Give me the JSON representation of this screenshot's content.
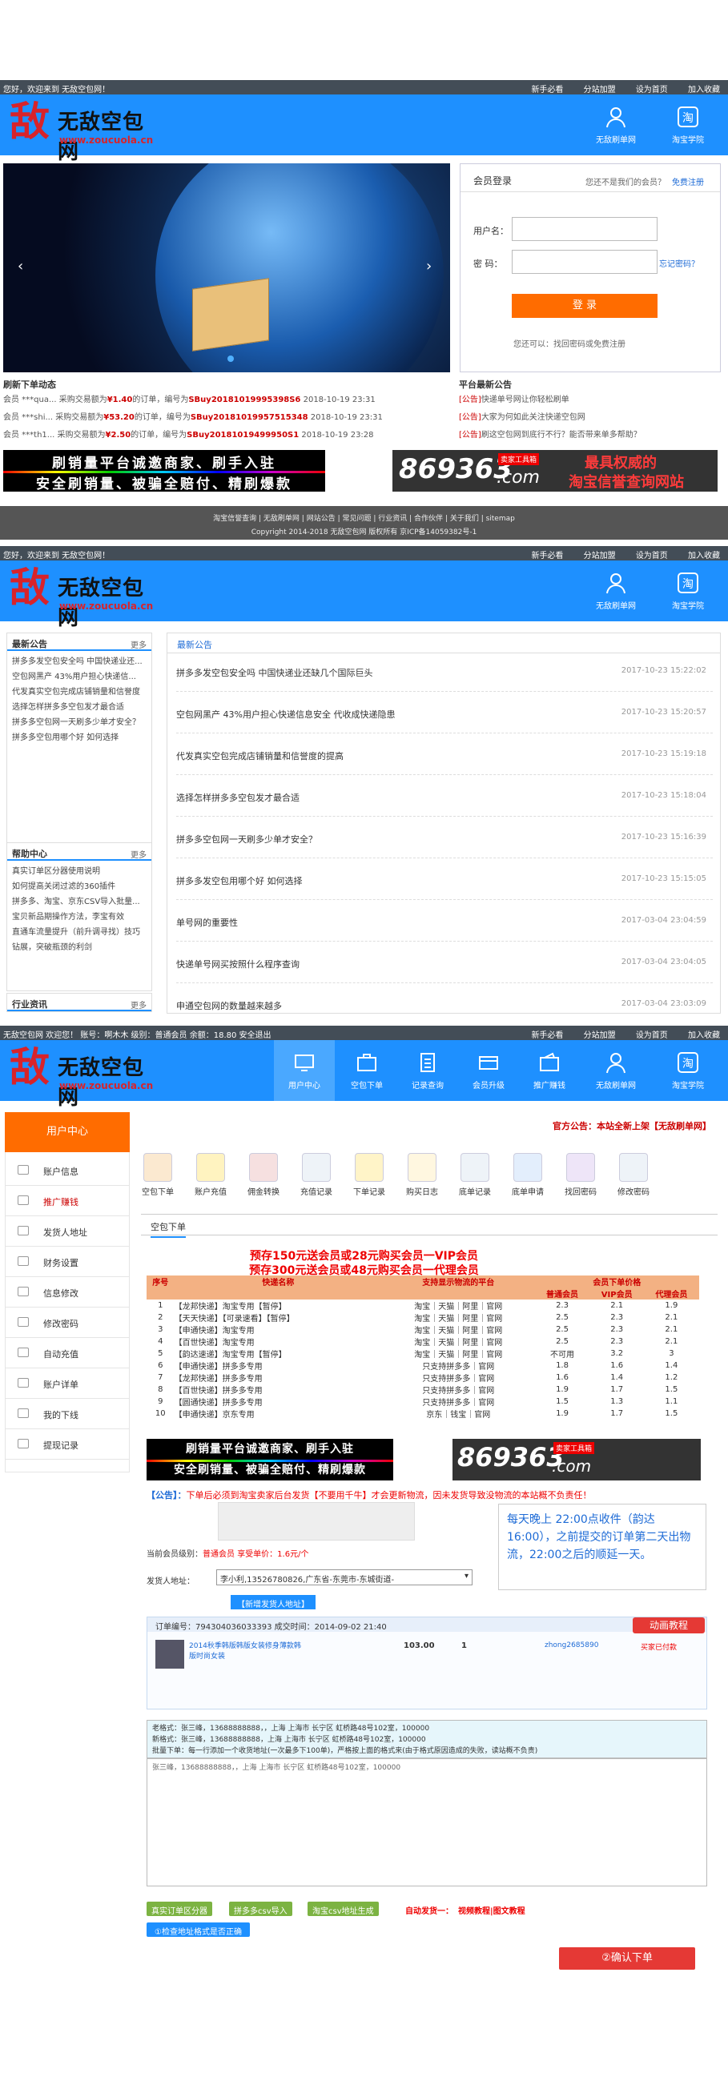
{
  "colors": {
    "brand_blue": "#1e90ff",
    "top_bar": "#434d57",
    "red": "#d8232a",
    "orange": "#ff6c00"
  },
  "topbar": {
    "welcome": "您好，欢迎来到 无敌空包网！",
    "links": [
      "新手必看",
      "分站加盟",
      "设为首页",
      "加入收藏"
    ],
    "welcome_user": "无敌空包网 欢迎您！  账号：啊木木 级别：普通会员 余额：18.80 安全退出"
  },
  "logo": {
    "name": "无敌空包网",
    "url": "www.zoucuola.cn",
    "glyph": "敌"
  },
  "header_nav": {
    "brush_net": "无敌刷单网",
    "taobao_school": "淘宝学院"
  },
  "member_nav": [
    "用户中心",
    "空包下单",
    "记录查询",
    "会员升级",
    "推广赚钱",
    "无敌刷单网",
    "淘宝学院"
  ],
  "login": {
    "title": "会员登录",
    "hint": "您还不是我们的会员？",
    "register": "免费注册",
    "user_label": "用户名：",
    "pass_label": "密  码：",
    "forgot": "忘记密码？",
    "submit": "登  录",
    "footer": "您还可以：找回密码或免费注册"
  },
  "recent_orders": {
    "title": "刷新下单动态",
    "rows": [
      {
        "user": "会员 ***qua...",
        "text": "采购交易额为",
        "amt": "¥1.40",
        "mid": "的订单，编号为",
        "code": "SBuy20181019995398S6",
        "time": "2018-10-19 23:31"
      },
      {
        "user": "会员 ***shi...",
        "text": "采购交易额为",
        "amt": "¥53.20",
        "mid": "的订单，编号为",
        "code": "SBuy20181019957515348",
        "time": "2018-10-19 23:31"
      },
      {
        "user": "会员 ***th1...",
        "text": "采购交易额为",
        "amt": "¥2.50",
        "mid": "的订单，编号为",
        "code": "SBuy20181019499950S1",
        "time": "2018-10-19 23:28"
      }
    ]
  },
  "platform_news": {
    "title": "平台最新公告",
    "rows": [
      {
        "tag": "[公告]",
        "text": "快递单号网让你轻松刷单"
      },
      {
        "tag": "[公告]",
        "text": "大家为何如此关注快递空包网"
      },
      {
        "tag": "[公告]",
        "text": "刷这空包网到底行不行？能否带来单多帮助？"
      }
    ]
  },
  "banner": {
    "line1": "刷销量平台诚邀商家、刷手入驻",
    "line2": "安全刷销量、被骗全赔付、精刷爆款"
  },
  "banner2": {
    "num": "869363",
    "com": ".com",
    "tag": "卖家工具箱",
    "t1": "最具权威的",
    "t2": "淘宝信誉查询网站"
  },
  "footer": {
    "links": [
      "淘宝信誉查询",
      "无敌刷单网",
      "网站公告",
      "常见问题",
      "行业资讯",
      "合作伙伴",
      "关于我们",
      "sitemap"
    ],
    "copy": "Copyright 2014-2018 无敌空包网 版权所有 京ICP备14059382号-1"
  },
  "sidebox1": {
    "title": "最新公告",
    "more": "更多",
    "items": [
      "拼多多发空包安全吗 中国快递业还...",
      "空包网黑产 43%用户担心快递信...",
      "代发真实空包完成店铺销量和信誉度",
      "选择怎样拼多多空包发才最合适",
      "拼多多空包网一天刷多少单才安全？",
      "拼多多空包用哪个好 如何选择"
    ]
  },
  "sidebox2": {
    "title": "帮助中心",
    "more": "更多",
    "items": [
      "真实订单区分器使用说明",
      "如何提高关闭过滤的360插件",
      "拼多多、淘宝、京东CSV导入批量...",
      "宝贝新品期操作方法，李宝有效",
      "直通车流量提升（前升调寻找）技巧",
      "钻展，突破瓶颈的利剑"
    ]
  },
  "sidebox3": {
    "title": "行业资讯",
    "more": "更多"
  },
  "notice_list": {
    "title": "最新公告",
    "items": [
      {
        "title": "拼多多发空包安全吗 中国快递业还缺几个国际巨头",
        "date": "2017-10-23 15:22:02"
      },
      {
        "title": "空包网黑产 43%用户担心快递信息安全 代收成快递隐患",
        "date": "2017-10-23 15:20:57"
      },
      {
        "title": "代发真实空包完成店铺销量和信誉度的提高",
        "date": "2017-10-23 15:19:18"
      },
      {
        "title": "选择怎样拼多多空包发才最合适",
        "date": "2017-10-23 15:18:04"
      },
      {
        "title": "拼多多空包网一天刷多少单才安全？",
        "date": "2017-10-23 15:16:39"
      },
      {
        "title": "拼多多发空包用哪个好 如何选择",
        "date": "2017-10-23 15:15:05"
      },
      {
        "title": "单号网的重要性",
        "date": "2017-03-04 23:04:59"
      },
      {
        "title": "快递单号网买按照什么程序查询",
        "date": "2017-03-04 23:04:05"
      },
      {
        "title": "申通空包网的数量越来越多",
        "date": "2017-03-04 23:03:09"
      }
    ]
  },
  "user_center": {
    "title": "用户中心",
    "official_notice": "官方公告：本站全新上架【无敌刷单网】",
    "menu": [
      "账户信息",
      "推广赚钱",
      "发货人地址",
      "财务设置",
      "信息修改",
      "修改密码",
      "自动充值",
      "账户详单",
      "我的下线",
      "提现记录"
    ],
    "tools": [
      "空包下单",
      "账户充值",
      "佣金转换",
      "充值记录",
      "下单记录",
      "购买日志",
      "底单记录",
      "底单申请",
      "找回密码",
      "修改密码"
    ],
    "tab": "空包下单",
    "promo1": "预存150元送会员或28元购买会员一VIP会员",
    "promo2": "预存300元送会员或48元购买会员一代理会员"
  },
  "price_table": {
    "headers": [
      "序号",
      "快递名称",
      "支持显示物流的平台",
      "普通会员",
      "VIP会员",
      "代理会员"
    ],
    "group_header": "会员下单价格",
    "rows": [
      [
        "1",
        "【龙邦快递】淘宝专用【暂停】",
        "淘宝｜天猫｜阿里｜官网",
        "2.3",
        "2.1",
        "1.9"
      ],
      [
        "2",
        "【天天快递】【可录速看】【暂停】",
        "淘宝｜天猫｜阿里｜官网",
        "2.5",
        "2.3",
        "2.1"
      ],
      [
        "3",
        "【申通快递】淘宝专用",
        "淘宝｜天猫｜阿里｜官网",
        "2.5",
        "2.3",
        "2.1"
      ],
      [
        "4",
        "【百世快递】淘宝专用",
        "淘宝｜天猫｜阿里｜官网",
        "2.5",
        "2.3",
        "2.1"
      ],
      [
        "5",
        "【韵达速递】淘宝专用【暂停】",
        "淘宝｜天猫｜阿里｜官网",
        "不可用",
        "3.2",
        "3"
      ],
      [
        "6",
        "【申通快递】拼多多专用",
        "只支持拼多多｜官网",
        "1.8",
        "1.6",
        "1.4"
      ],
      [
        "7",
        "【龙邦快递】拼多多专用",
        "只支持拼多多｜官网",
        "1.6",
        "1.4",
        "1.2"
      ],
      [
        "8",
        "【百世快递】拼多多专用",
        "只支持拼多多｜官网",
        "1.9",
        "1.7",
        "1.5"
      ],
      [
        "9",
        "【圆通快递】拼多多专用",
        "只支持拼多多｜官网",
        "1.5",
        "1.3",
        "1.1"
      ],
      [
        "10",
        "【申通快递】京东专用",
        "京东｜钱宝｜官网",
        "1.9",
        "1.7",
        "1.5"
      ]
    ]
  },
  "order_form": {
    "notice_label": "【公告】：",
    "notice": "下单后必须到淘宝卖家后台发货【不要用千牛】才会更新物流，因未发货导致没物流的本站概不负责任！",
    "schedule": "每天晚上 22:00点收件（韵达16:00），之前提交的订单第二天出物流，22:00之后的顺延一天。",
    "level_label": "当前会员级别：",
    "level": "普通会员",
    "discount": "享受单价：1.6元/个",
    "sender_label": "发货人地址：",
    "sender": "李小利,13526780826,广东省-东莞市-东城街道-",
    "add_sender": "【新增发货人地址】",
    "sample_order": "订单编号：794304036033393    成交时间：2014-09-02 21:40",
    "anim": "动画教程",
    "item_title": "2014秋季韩版韩版女装修身薄款韩版时尚女装",
    "price": "103.00",
    "qty": "1",
    "seller": "zhong2685890",
    "status": "买家已付款",
    "textarea_hint": "老格式：张三峰，13688888888，，上海 上海市 长宁区 虹桥路48号102室，100000\n新格式：张三峰，13688888888，上海 上海市 长宁区 虹桥路48号102室，100000\n批量下单：每一行添加一个收货地址(一次最多下100单)，严格按上面的格式来(由于格式原因造成的失败，读站概不负责)",
    "textarea_value": "张三峰，13688888888，，上海 上海市 长宁区 虹桥路48号102室，100000",
    "btn1": "真实订单区分器",
    "btn2": "拼多多csv导入",
    "btn3": "淘宝csv地址生成",
    "auto_label": "自动发货一：",
    "auto_link": "视频教程|图文教程",
    "check": "①检查地址格式是否正确",
    "submit": "②确认下单"
  }
}
